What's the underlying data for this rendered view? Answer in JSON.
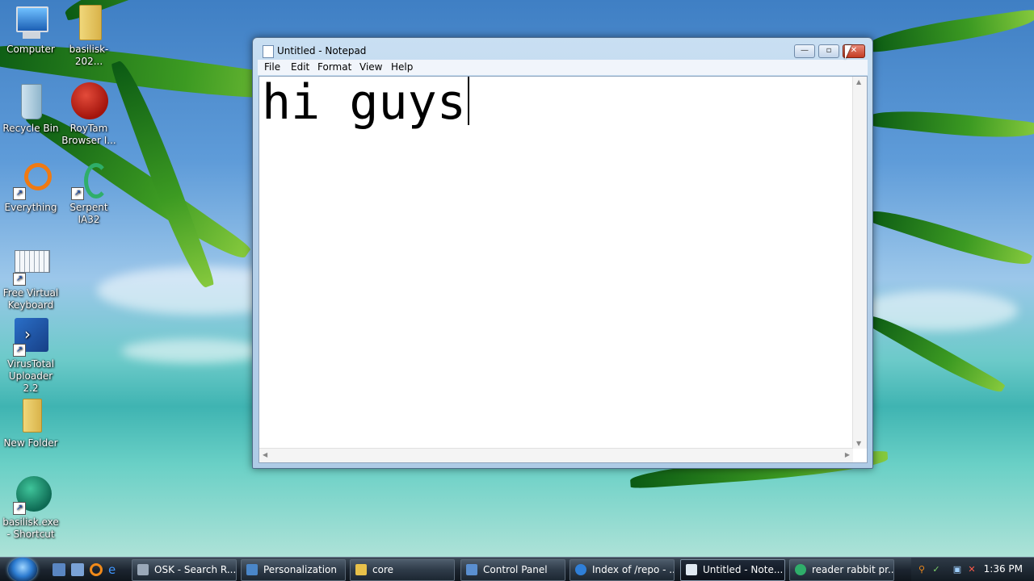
{
  "desktop": {
    "icons": [
      {
        "label": "Computer"
      },
      {
        "label": "basilisk-202..."
      },
      {
        "label": "Recycle Bin"
      },
      {
        "label": "RoyTam Browser I..."
      },
      {
        "label": "Everything"
      },
      {
        "label": "Serpent IA32"
      },
      {
        "label": "Free Virtual Keyboard"
      },
      {
        "label": "VirusTotal Uploader 2.2"
      },
      {
        "label": "New Folder"
      },
      {
        "label": "basilisk.exe - Shortcut"
      }
    ]
  },
  "notepad": {
    "title": "Untitled - Notepad",
    "menu": [
      "File",
      "Edit",
      "Format",
      "View",
      "Help"
    ],
    "content": "hi guys",
    "buttons": {
      "minimize": "—",
      "maximize": "▫",
      "close": "✕"
    }
  },
  "taskbar": {
    "tasks": [
      {
        "label": "OSK - Search R...",
        "icon_color": "#9aa8b8",
        "active": false
      },
      {
        "label": "Personalization",
        "icon_color": "#4a86c8",
        "active": false
      },
      {
        "label": "core",
        "icon_color": "#e8c14a",
        "active": false
      },
      {
        "label": "Control Panel",
        "icon_color": "#5a8fd0",
        "active": false
      },
      {
        "label": "Index of /repo - ...",
        "icon_color": "#2f7fd8",
        "active": false
      },
      {
        "label": "Untitled - Note...",
        "icon_color": "#dfe8f2",
        "active": true
      },
      {
        "label": "reader rabbit pr...",
        "icon_color": "#2fae6a",
        "active": false
      }
    ],
    "clock": "1:36 PM"
  },
  "colors": {
    "taskbar": "#1c2530",
    "window_frame": "#b7d1ea",
    "close_button": "#c43b22"
  }
}
